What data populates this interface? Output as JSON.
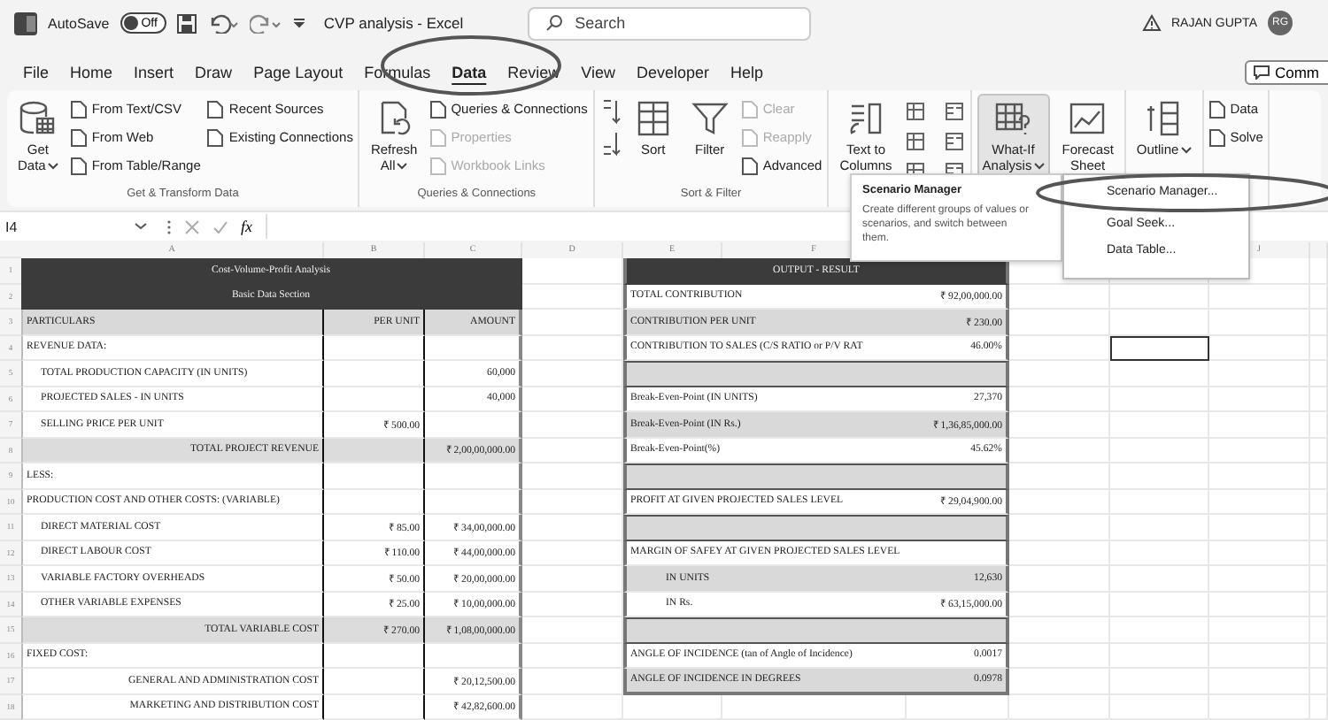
{
  "title_bar": {
    "autosave_label": "AutoSave",
    "autosave": {
      "on": false,
      "label": "Off"
    },
    "document_title": "CVP analysis - Excel",
    "search": {
      "placeholder": "Search"
    },
    "user_name": "RAJAN GUPTA",
    "avatar_initials": "RG"
  },
  "tabs": [
    {
      "label": "File",
      "selected": false
    },
    {
      "label": "Home",
      "selected": false
    },
    {
      "label": "Insert",
      "selected": false
    },
    {
      "label": "Draw",
      "selected": false
    },
    {
      "label": "Page Layout",
      "selected": false
    },
    {
      "label": "Formulas",
      "selected": false
    },
    {
      "label": "Data",
      "selected": true
    },
    {
      "label": "Review",
      "selected": false
    },
    {
      "label": "View",
      "selected": false
    },
    {
      "label": "Developer",
      "selected": false
    },
    {
      "label": "Help",
      "selected": false
    }
  ],
  "comments_button": "Comm",
  "ribbon": {
    "groups": [
      {
        "label": "Get & Transform Data",
        "items": [
          {
            "kind": "large",
            "lines": [
              "Get",
              "Data"
            ],
            "has_menu": true,
            "pressed": false
          },
          {
            "kind": "column",
            "items": [
              {
                "label": "From Text/CSV",
                "disabled": false
              },
              {
                "label": "From Web",
                "disabled": false
              },
              {
                "label": "From Table/Range",
                "disabled": false
              }
            ]
          },
          {
            "kind": "column",
            "items": [
              {
                "label": "Recent Sources",
                "disabled": false
              },
              {
                "label": "Existing Connections",
                "disabled": false
              }
            ]
          }
        ]
      },
      {
        "label": "Queries & Connections",
        "items": [
          {
            "kind": "large",
            "lines": [
              "Refresh",
              "All"
            ],
            "has_menu": true,
            "pressed": false
          },
          {
            "kind": "column",
            "items": [
              {
                "label": "Queries & Connections",
                "disabled": false
              },
              {
                "label": "Properties",
                "disabled": true
              },
              {
                "label": "Workbook Links",
                "disabled": true
              }
            ]
          }
        ]
      },
      {
        "label": "Sort & Filter",
        "items": [
          {
            "kind": "sort_icons"
          },
          {
            "kind": "large",
            "lines": [
              "Sort"
            ],
            "has_menu": false,
            "pressed": false
          },
          {
            "kind": "large",
            "lines": [
              "Filter"
            ],
            "has_menu": false,
            "pressed": false
          },
          {
            "kind": "column",
            "items": [
              {
                "label": "Clear",
                "disabled": true
              },
              {
                "label": "Reapply",
                "disabled": true
              },
              {
                "label": "Advanced",
                "disabled": false
              }
            ]
          }
        ]
      },
      {
        "items": [
          {
            "kind": "large",
            "lines": [
              "Text to",
              "Columns"
            ],
            "has_menu": false,
            "pressed": false
          },
          {
            "kind": "tool_icons"
          }
        ]
      },
      {
        "items": [
          {
            "kind": "large",
            "lines": [
              "What-If",
              "Analysis"
            ],
            "has_menu": true,
            "pressed": true
          },
          {
            "kind": "large",
            "lines": [
              "Forecast",
              "Sheet"
            ],
            "has_menu": false,
            "pressed": false
          }
        ]
      },
      {
        "items": [
          {
            "kind": "large",
            "lines": [
              "Outline"
            ],
            "has_menu": true,
            "pressed": false
          }
        ]
      },
      {
        "items": [
          {
            "kind": "column",
            "items": [
              {
                "label": "Data",
                "disabled": false
              },
              {
                "label": "Solve",
                "disabled": false
              }
            ]
          }
        ]
      }
    ]
  },
  "formula_bar": {
    "name_box": "I4",
    "fx": "fx"
  },
  "sheet": {
    "column_headers": [
      "A",
      "B",
      "C",
      "D",
      "E",
      "F",
      "J"
    ],
    "rows": [
      {
        "number": "1",
        "selected": false,
        "left": {
          "kind": "title",
          "label": "Cost-Volume-Profit Analysis"
        },
        "right": {
          "kind": "title",
          "label": "OUTPUT - RESULT"
        }
      },
      {
        "number": "2",
        "selected": false,
        "left": {
          "kind": "title",
          "label": "Basic Data Section"
        },
        "right": {
          "kind": "row",
          "shaded": false,
          "indented": false,
          "label": "TOTAL CONTRIBUTION",
          "value": "₹ 92,00,000.00"
        }
      },
      {
        "number": "3",
        "selected": false,
        "left": {
          "kind": "header",
          "label": "PARTICULARS",
          "per_unit": "PER UNIT",
          "amount": "AMOUNT"
        },
        "right": {
          "kind": "row",
          "shaded": true,
          "indented": false,
          "label": "CONTRIBUTION PER UNIT",
          "value": "₹ 230.00"
        }
      },
      {
        "number": "4",
        "selected": true,
        "left": {
          "kind": "section",
          "label": "REVENUE DATA:"
        },
        "right": {
          "kind": "row",
          "shaded": false,
          "indented": false,
          "label": "CONTRIBUTION TO SALES (C/S RATIO or P/V RAT",
          "value": "46.00%"
        }
      },
      {
        "number": "5",
        "selected": false,
        "left": {
          "kind": "item",
          "label": "TOTAL PRODUCTION CAPACITY (IN UNITS)",
          "amount": "60,000"
        },
        "right": {
          "kind": "row",
          "shaded": true,
          "indented": false
        }
      },
      {
        "number": "6",
        "selected": false,
        "left": {
          "kind": "item",
          "label": "PROJECTED SALES - IN UNITS",
          "amount": "40,000"
        },
        "right": {
          "kind": "row",
          "shaded": false,
          "indented": false,
          "label": "Break-Even-Point (IN UNITS)",
          "value": "27,370"
        }
      },
      {
        "number": "7",
        "selected": false,
        "left": {
          "kind": "item",
          "label": "SELLING PRICE PER UNIT",
          "per_unit": "₹ 500.00"
        },
        "right": {
          "kind": "row",
          "shaded": true,
          "indented": false,
          "label": "Break-Even-Point (IN Rs.)",
          "value": "₹ 1,36,85,000.00"
        }
      },
      {
        "number": "8",
        "selected": false,
        "left": {
          "kind": "total",
          "label": "TOTAL PROJECT REVENUE",
          "amount": "₹ 2,00,00,000.00"
        },
        "right": {
          "kind": "row",
          "shaded": false,
          "indented": false,
          "label": "Break-Even-Point(%)",
          "value": "45.62%"
        }
      },
      {
        "number": "9",
        "selected": false,
        "left": {
          "kind": "section",
          "label": "LESS:"
        },
        "right": {
          "kind": "row",
          "shaded": true,
          "indented": false
        }
      },
      {
        "number": "10",
        "selected": false,
        "left": {
          "kind": "section",
          "label": "PRODUCTION COST AND OTHER COSTS: (VARIABLE)"
        },
        "right": {
          "kind": "row",
          "shaded": false,
          "indented": false,
          "label": "PROFIT AT GIVEN PROJECTED SALES LEVEL",
          "value": "₹ 29,04,900.00"
        }
      },
      {
        "number": "11",
        "selected": false,
        "left": {
          "kind": "item",
          "label": "DIRECT MATERIAL COST",
          "per_unit": "₹ 85.00",
          "amount": "₹ 34,00,000.00"
        },
        "right": {
          "kind": "row",
          "shaded": true,
          "indented": false
        }
      },
      {
        "number": "12",
        "selected": false,
        "left": {
          "kind": "item",
          "label": "DIRECT LABOUR COST",
          "per_unit": "₹ 110.00",
          "amount": "₹ 44,00,000.00"
        },
        "right": {
          "kind": "row",
          "shaded": false,
          "indented": false,
          "label": "MARGIN OF SAFEY AT GIVEN PROJECTED SALES LEVEL"
        }
      },
      {
        "number": "13",
        "selected": false,
        "left": {
          "kind": "item",
          "label": "VARIABLE FACTORY OVERHEADS",
          "per_unit": "₹ 50.00",
          "amount": "₹ 20,00,000.00"
        },
        "right": {
          "kind": "row",
          "shaded": true,
          "indented": true,
          "label": "IN UNITS",
          "value": "12,630"
        }
      },
      {
        "number": "14",
        "selected": false,
        "left": {
          "kind": "item",
          "label": "OTHER VARIABLE EXPENSES",
          "per_unit": "₹ 25.00",
          "amount": "₹ 10,00,000.00"
        },
        "right": {
          "kind": "row",
          "shaded": false,
          "indented": true,
          "label": "IN Rs.",
          "value": "₹ 63,15,000.00"
        }
      },
      {
        "number": "15",
        "selected": false,
        "left": {
          "kind": "total",
          "label": "TOTAL VARIABLE COST",
          "per_unit": "₹ 270.00",
          "amount": "₹ 1,08,00,000.00"
        },
        "right": {
          "kind": "row",
          "shaded": true,
          "indented": false
        }
      },
      {
        "number": "16",
        "selected": false,
        "left": {
          "kind": "section",
          "label": "FIXED COST:"
        },
        "right": {
          "kind": "row",
          "shaded": false,
          "indented": false,
          "label": "ANGLE OF INCIDENCE (tan of Angle of Incidence)",
          "value": "0.0017"
        }
      },
      {
        "number": "17",
        "selected": false,
        "left": {
          "kind": "right_item",
          "label": "GENERAL AND ADMINISTRATION COST",
          "amount": "₹ 20,12,500.00"
        },
        "right": {
          "kind": "row",
          "shaded": true,
          "indented": false,
          "label": "ANGLE OF INCIDENCE IN DEGREES",
          "value": "0.0978"
        }
      },
      {
        "number": "18",
        "selected": false,
        "left": {
          "kind": "right_item",
          "label": "MARKETING AND DISTRIBUTION COST",
          "amount": "₹ 42,82,600.00"
        }
      }
    ]
  },
  "tooltip": {
    "title": "Scenario Manager",
    "text": "Create different groups of values or scenarios, and switch between them."
  },
  "menu": {
    "items": [
      "Scenario Manager...",
      "Goal Seek...",
      "Data Table..."
    ]
  }
}
